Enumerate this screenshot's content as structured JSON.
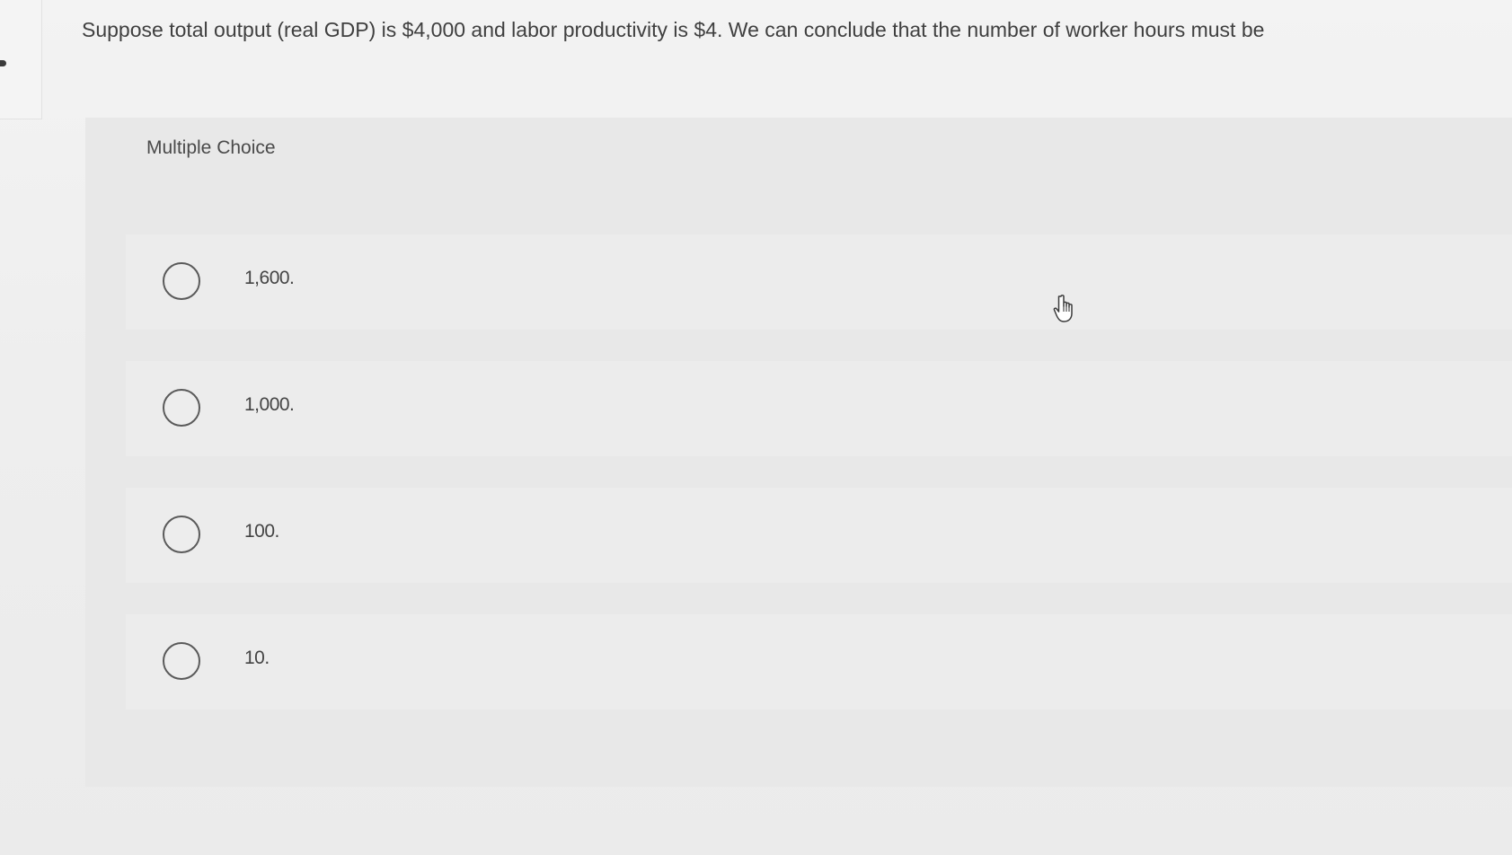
{
  "question": {
    "text": "Suppose total output (real GDP) is $4,000 and labor productivity is $4. We can conclude that the number of worker hours must be"
  },
  "multiple_choice": {
    "label": "Multiple Choice",
    "selected": null,
    "options": [
      {
        "label": "1,600."
      },
      {
        "label": "1,000."
      },
      {
        "label": "100."
      },
      {
        "label": "10."
      }
    ]
  },
  "icons": {
    "radio": "radio-unselected-icon",
    "pointer": "hand-pointer-icon"
  },
  "colors": {
    "background": "#efefef",
    "panel": "#e8e8e8",
    "option_row": "#ececec",
    "text": "#3f3f3f",
    "radio_border": "#5a5a5a"
  }
}
